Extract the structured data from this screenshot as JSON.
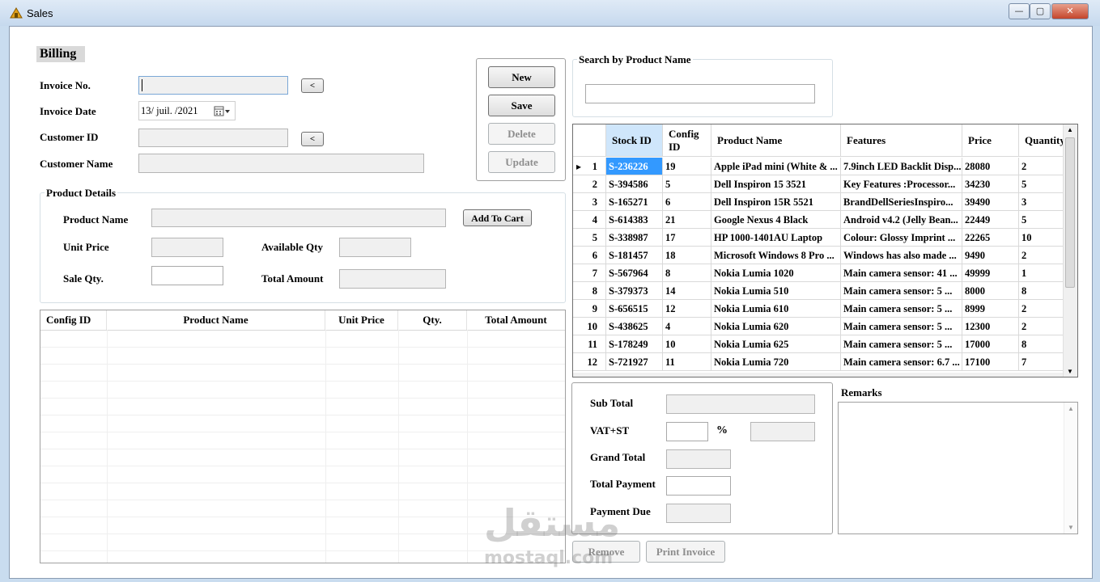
{
  "window": {
    "title": "Sales",
    "controls": {
      "minimize": "—",
      "maximize": "▢",
      "close": "✕"
    }
  },
  "billing": {
    "header": "Billing"
  },
  "invoice": {
    "invoice_no_label": "Invoice No.",
    "invoice_no_value": "",
    "browse_label": "<",
    "invoice_date_label": "Invoice Date",
    "invoice_date_value": "13/ juil. /2021",
    "customer_id_label": "Customer ID",
    "customer_id_value": "",
    "customer_browse_label": "<",
    "customer_name_label": "Customer Name",
    "customer_name_value": ""
  },
  "actions": {
    "new": "New",
    "save": "Save",
    "delete": "Delete",
    "update": "Update"
  },
  "search": {
    "title": "Search by Product Name",
    "value": ""
  },
  "product_details": {
    "title": "Product Details",
    "product_name_label": "Product Name",
    "unit_price_label": "Unit Price",
    "available_qty_label": "Available Qty",
    "sale_qty_label": "Sale Qty.",
    "total_amount_label": "Total Amount",
    "add_to_cart": "Add To Cart"
  },
  "cart": {
    "columns": [
      "Config ID",
      "Product Name",
      "Unit Price",
      "Qty.",
      "Total Amount"
    ]
  },
  "stock": {
    "columns": [
      "Stock ID",
      "Config ID",
      "Product Name",
      "Features",
      "Price",
      "Quantity"
    ],
    "selected_row": 1,
    "rows": [
      {
        "n": "1",
        "stock_id": "S-236226",
        "config_id": "19",
        "product": "Apple iPad mini (White & ...",
        "features": "7.9inch LED Backlit Disp...",
        "price": "28080",
        "qty": "2"
      },
      {
        "n": "2",
        "stock_id": "S-394586",
        "config_id": "5",
        "product": "Dell Inspiron 15 3521",
        "features": "Key Features :Processor...",
        "price": "34230",
        "qty": "5"
      },
      {
        "n": "3",
        "stock_id": "S-165271",
        "config_id": "6",
        "product": "Dell Inspiron 15R 5521",
        "features": "BrandDellSeriesInspiro...",
        "price": "39490",
        "qty": "3"
      },
      {
        "n": "4",
        "stock_id": "S-614383",
        "config_id": "21",
        "product": "Google Nexus 4 Black",
        "features": "Android v4.2 (Jelly Bean...",
        "price": "22449",
        "qty": "5"
      },
      {
        "n": "5",
        "stock_id": "S-338987",
        "config_id": "17",
        "product": "HP 1000-1401AU Laptop",
        "features": "Colour: Glossy Imprint ...",
        "price": "22265",
        "qty": "10"
      },
      {
        "n": "6",
        "stock_id": "S-181457",
        "config_id": "18",
        "product": "Microsoft Windows 8 Pro ...",
        "features": "Windows has also made ...",
        "price": "9490",
        "qty": "2"
      },
      {
        "n": "7",
        "stock_id": "S-567964",
        "config_id": "8",
        "product": "Nokia Lumia 1020",
        "features": "Main camera sensor: 41 ...",
        "price": "49999",
        "qty": "1"
      },
      {
        "n": "8",
        "stock_id": "S-379373",
        "config_id": "14",
        "product": "Nokia Lumia 510",
        "features": "Main camera sensor: 5 ...",
        "price": "8000",
        "qty": "8"
      },
      {
        "n": "9",
        "stock_id": "S-656515",
        "config_id": "12",
        "product": "Nokia Lumia 610",
        "features": "Main camera sensor: 5 ...",
        "price": "8999",
        "qty": "2"
      },
      {
        "n": "10",
        "stock_id": "S-438625",
        "config_id": "4",
        "product": "Nokia Lumia 620",
        "features": "Main camera sensor: 5 ...",
        "price": "12300",
        "qty": "2"
      },
      {
        "n": "11",
        "stock_id": "S-178249",
        "config_id": "10",
        "product": "Nokia Lumia 625",
        "features": "Main camera sensor: 5 ...",
        "price": "17000",
        "qty": "8"
      },
      {
        "n": "12",
        "stock_id": "S-721927",
        "config_id": "11",
        "product": "Nokia Lumia 720",
        "features": "Main camera sensor: 6.7 ...",
        "price": "17100",
        "qty": "7"
      }
    ]
  },
  "totals": {
    "sub_total_label": "Sub Total",
    "vat_label": "VAT+ST",
    "percent_sign": "%",
    "grand_total_label": "Grand Total",
    "total_payment_label": "Total Payment",
    "payment_due_label": "Payment Due"
  },
  "remarks": {
    "label": "Remarks",
    "value": ""
  },
  "footer": {
    "remove": "Remove",
    "print_invoice": "Print Invoice"
  },
  "watermark": {
    "arabic": "مستقل",
    "latin": "mostaql.com"
  },
  "icons": {
    "app": "app-icon",
    "calendar": "calendar-icon",
    "row_indicator": "row-pointer-icon"
  },
  "colors": {
    "selection": "#3399ff",
    "titlebar": "#c9dcef"
  }
}
